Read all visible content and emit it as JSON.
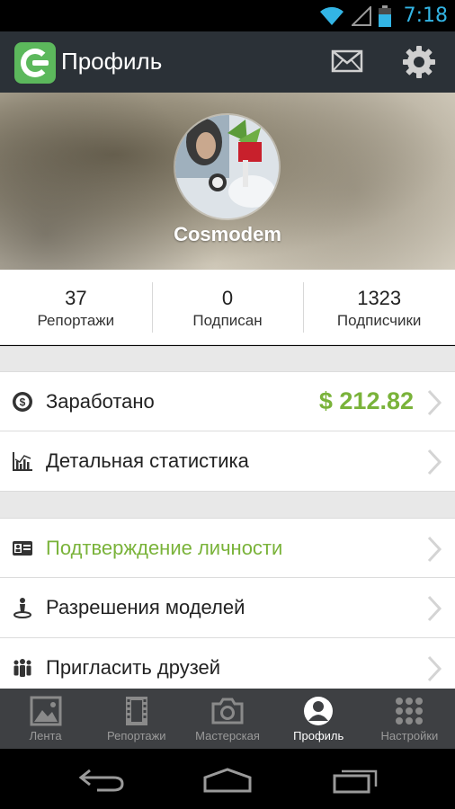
{
  "status_bar": {
    "time": "7:18",
    "icons": [
      "wifi-icon",
      "signal-icon",
      "battery-icon"
    ],
    "accent": "#33b5e5"
  },
  "action_bar": {
    "title": "Профиль",
    "logo": "app-logo",
    "actions": [
      "mail-icon",
      "gear-icon"
    ],
    "brand_color": "#5cb85c",
    "bg": "#2b3137"
  },
  "profile": {
    "username": "Cosmodem"
  },
  "stats": [
    {
      "value": "37",
      "label": "Репортажи"
    },
    {
      "value": "0",
      "label": "Подписан"
    },
    {
      "value": "1323",
      "label": "Подписчики"
    }
  ],
  "menu": {
    "earned": {
      "label": "Заработано",
      "value": "$ 212.82",
      "icon": "coin-icon"
    },
    "stats": {
      "label": "Детальная статистика",
      "icon": "chart-icon"
    },
    "identity": {
      "label": "Подтверждение личности",
      "icon": "id-card-icon",
      "color": "#7ab33a"
    },
    "models": {
      "label": "Разрешения моделей",
      "icon": "person-icon"
    },
    "invite": {
      "label": "Пригласить друзей",
      "icon": "people-icon"
    }
  },
  "tabs": [
    {
      "label": "Лента",
      "icon": "image-icon",
      "active": false
    },
    {
      "label": "Репортажи",
      "icon": "film-icon",
      "active": false
    },
    {
      "label": "Мастерская",
      "icon": "camera-icon",
      "active": false
    },
    {
      "label": "Профиль",
      "icon": "profile-icon",
      "active": true
    },
    {
      "label": "Настройки",
      "icon": "grid-icon",
      "active": false
    }
  ],
  "nav": [
    "back-icon",
    "home-icon",
    "recents-icon"
  ]
}
